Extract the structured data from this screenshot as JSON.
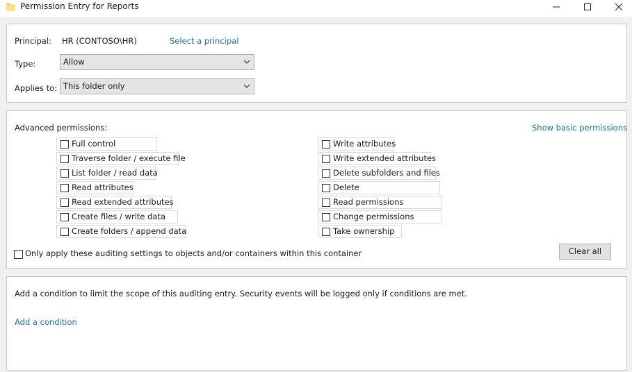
{
  "window": {
    "title": "Permission Entry for Reports",
    "icons": {
      "app": "folder-icon",
      "min": "minimize-icon",
      "max": "maximize-icon",
      "close": "close-icon"
    }
  },
  "principal": {
    "label": "Principal:",
    "value": "HR (CONTOSO\\HR)",
    "select_link": "Select a principal"
  },
  "type": {
    "label": "Type:",
    "value": "Allow"
  },
  "applies_to": {
    "label": "Applies to:",
    "value": "This folder only"
  },
  "advanced": {
    "label": "Advanced permissions:",
    "show_basic_link": "Show basic permissions",
    "left": [
      {
        "label": "Full control",
        "checked": false
      },
      {
        "label": "Traverse folder / execute file",
        "checked": false
      },
      {
        "label": "List folder / read data",
        "checked": false
      },
      {
        "label": "Read attributes",
        "checked": false
      },
      {
        "label": "Read extended attributes",
        "checked": false
      },
      {
        "label": "Create files / write data",
        "checked": false
      },
      {
        "label": "Create folders / append data",
        "checked": false
      }
    ],
    "right": [
      {
        "label": "Write attributes",
        "checked": false
      },
      {
        "label": "Write extended attributes",
        "checked": false
      },
      {
        "label": "Delete subfolders and files",
        "checked": false
      },
      {
        "label": "Delete",
        "checked": false
      },
      {
        "label": "Read permissions",
        "checked": false
      },
      {
        "label": "Change permissions",
        "checked": false
      },
      {
        "label": "Take ownership",
        "checked": false
      }
    ],
    "only_apply_label": "Only apply these auditing settings to objects and/or containers within this container",
    "clear_all": "Clear all"
  },
  "condition": {
    "text": "Add a condition to limit the scope of this auditing entry. Security events will be logged only if conditions are met.",
    "add_link": "Add a condition"
  },
  "colors": {
    "link": "#1a6db3",
    "panel_border": "#c9c9c9",
    "background": "#f0f0f0"
  }
}
